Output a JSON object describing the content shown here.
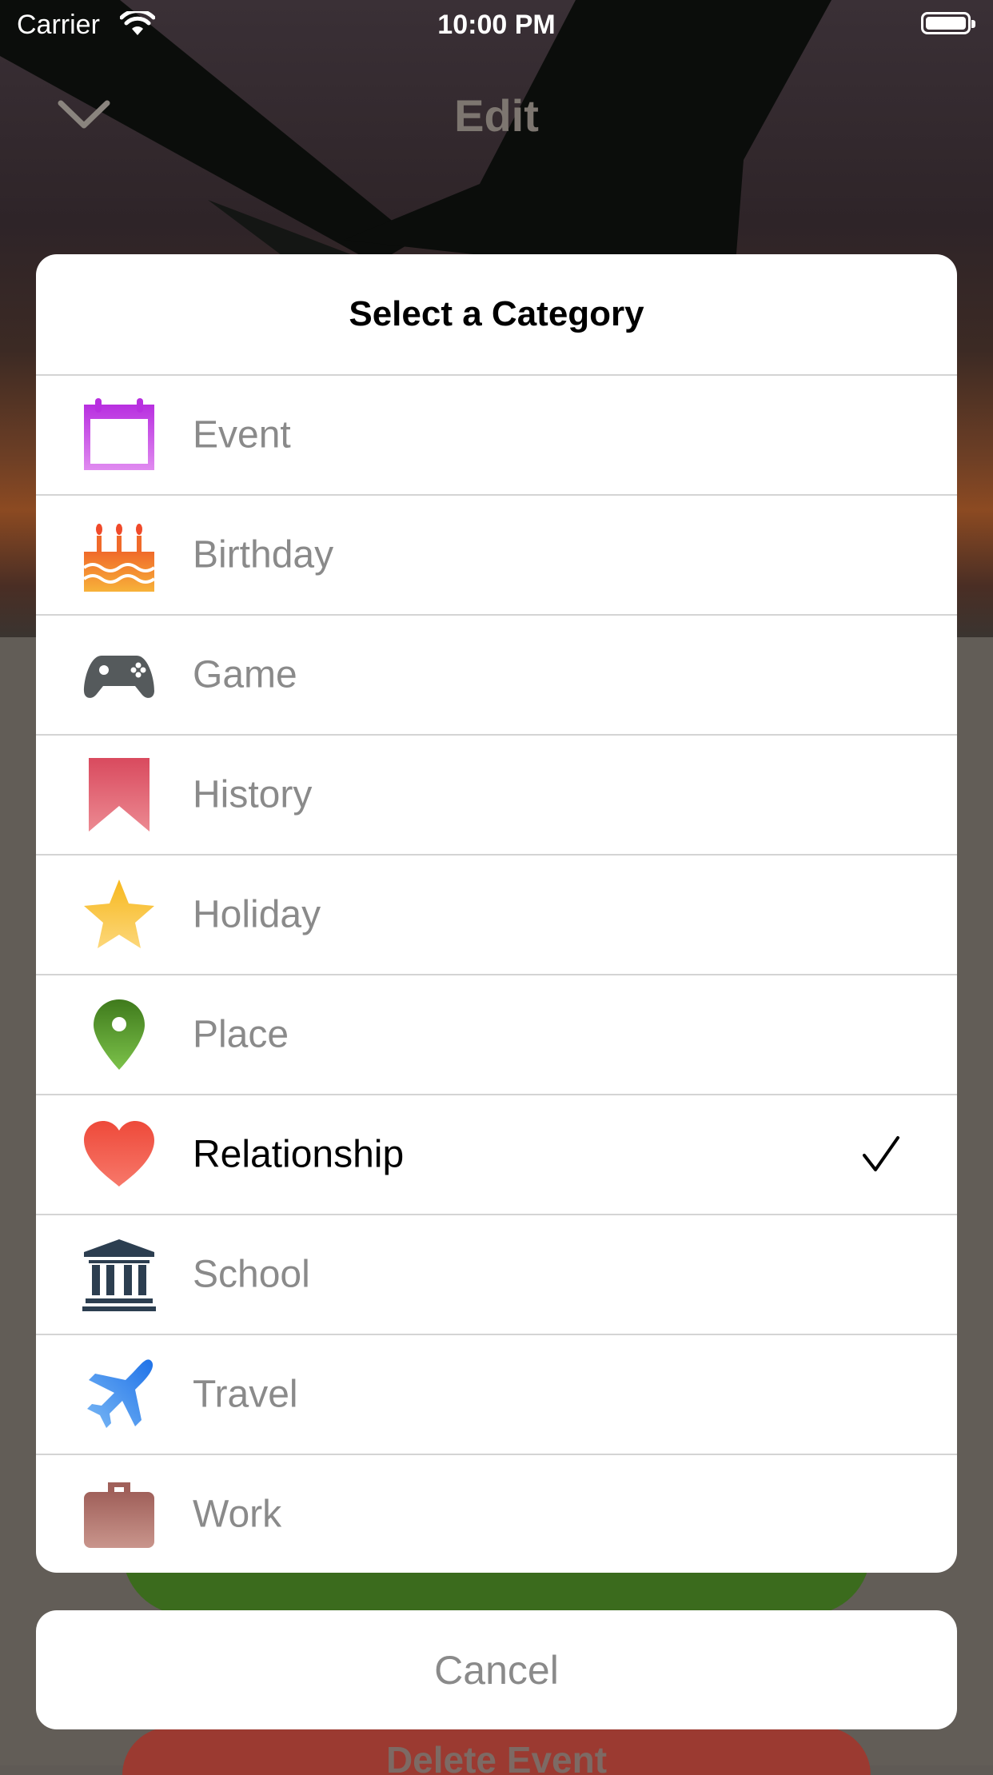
{
  "status_bar": {
    "carrier": "Carrier",
    "time": "10:00 PM"
  },
  "nav": {
    "title": "Edit"
  },
  "sheet": {
    "title": "Select a Category",
    "items": [
      {
        "label": "Event",
        "icon": "calendar-icon",
        "selected": false
      },
      {
        "label": "Birthday",
        "icon": "birthday-cake-icon",
        "selected": false
      },
      {
        "label": "Game",
        "icon": "gamepad-icon",
        "selected": false
      },
      {
        "label": "History",
        "icon": "bookmark-icon",
        "selected": false
      },
      {
        "label": "Holiday",
        "icon": "star-icon",
        "selected": false
      },
      {
        "label": "Place",
        "icon": "map-pin-icon",
        "selected": false
      },
      {
        "label": "Relationship",
        "icon": "heart-icon",
        "selected": true
      },
      {
        "label": "School",
        "icon": "school-building-icon",
        "selected": false
      },
      {
        "label": "Travel",
        "icon": "airplane-icon",
        "selected": false
      },
      {
        "label": "Work",
        "icon": "briefcase-icon",
        "selected": false
      }
    ]
  },
  "cancel_label": "Cancel",
  "background_button_label": "Delete Event"
}
